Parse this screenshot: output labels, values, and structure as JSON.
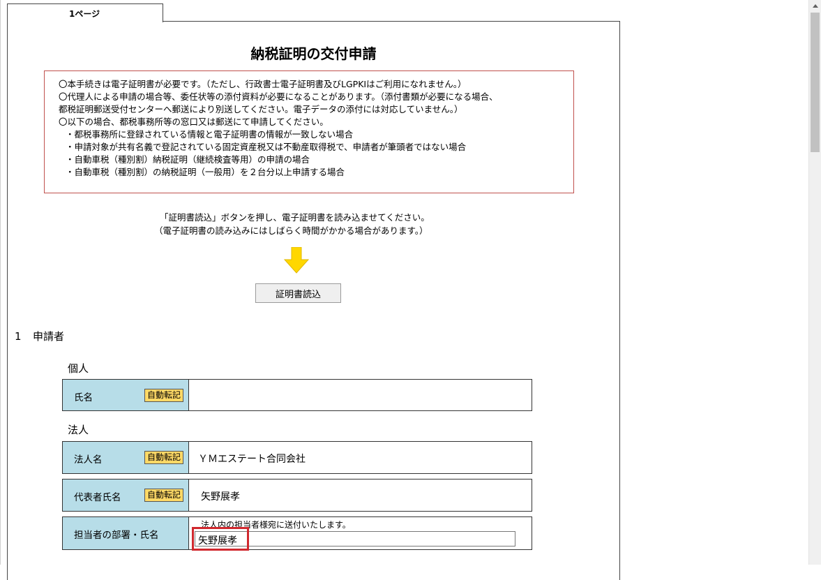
{
  "tab": {
    "label": "1ページ"
  },
  "form": {
    "title": "納税証明の交付申請",
    "notice_lines": [
      "〇本手続きは電子証明書が必要です。（ただし、行政書士電子証明書及びLGPKIはご利用になれません。）",
      "〇代理人による申請の場合等、委任状等の添付資料が必要になることがあります。（添付書類が必要になる場合、",
      "都税証明郵送受付センターへ郵送により別送してください。電子データの添付には対応していません。）",
      "〇以下の場合、都税事務所等の窓口又は郵送にて申請してください。",
      "・都税事務所に登録されている情報と電子証明書の情報が一致しない場合",
      "・申請対象が共有名義で登記されている固定資産税又は不動産取得税で、申請者が筆頭者ではない場合",
      "・自動車税（種別割）納税証明（継続検査等用）の申請の場合",
      "・自動車税（種別割）の納税証明（一般用）を２台分以上申請する場合"
    ],
    "instructions": [
      "「証明書読込」ボタンを押し、電子証明書を読み込ませてください。",
      "（電子証明書の読み込みにはしばらく時間がかかる場合があります。）"
    ],
    "read_cert_button": "証明書読込",
    "applicant": {
      "number": "1",
      "heading": "申請者",
      "individual": {
        "label": "個人",
        "name_label": "氏名",
        "auto_badge": "自動転記",
        "name_value": ""
      },
      "corporation": {
        "label": "法人",
        "corp_name_label": "法人名",
        "corp_name_badge": "自動転記",
        "corp_name_value": "ＹＭエステート合同会社",
        "rep_label": "代表者氏名",
        "rep_badge": "自動転記",
        "rep_value": "矢野展孝",
        "contact_label": "担当者の部署・氏名",
        "contact_note": "法人内の担当者様宛に送付いたします。",
        "contact_value": "矢野展孝"
      }
    }
  },
  "colors": {
    "label_bg": "#b7dde8",
    "badge_bg": "#ffd966",
    "notice_border": "#c0504d",
    "arrow": "#ffd700",
    "highlight": "#d0282e"
  }
}
